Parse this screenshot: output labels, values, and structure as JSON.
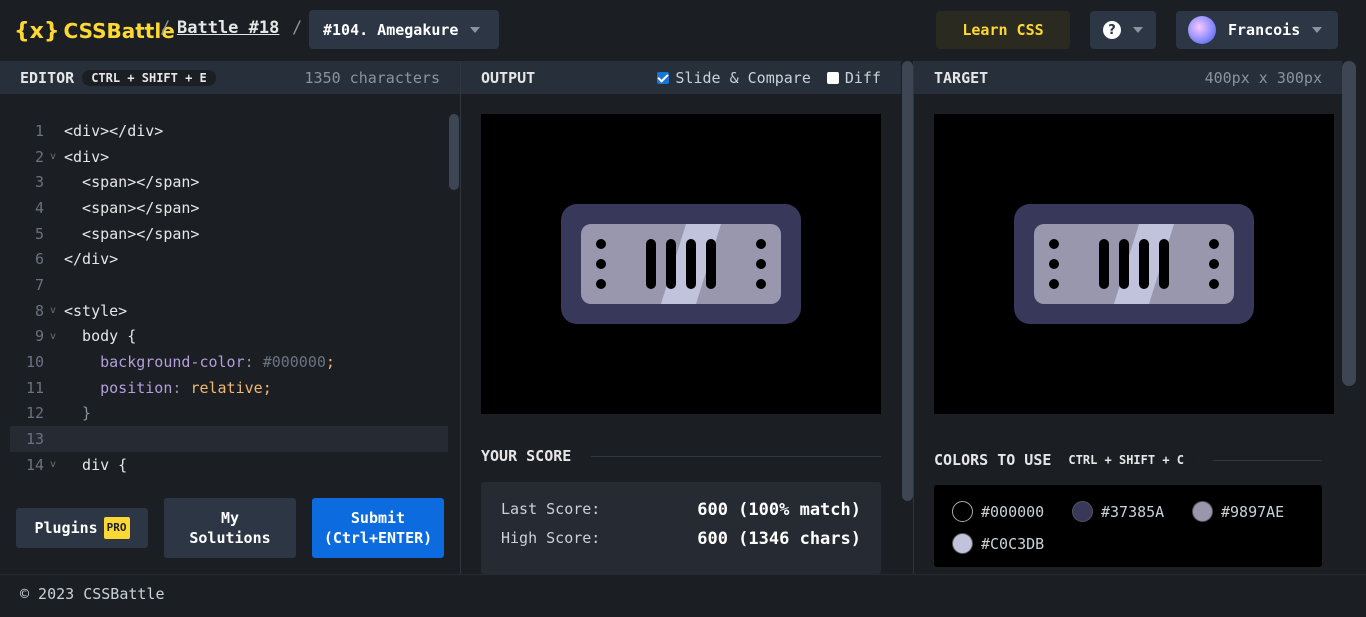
{
  "header": {
    "logo_text": "CSSBattle",
    "logo_mark": "{x}",
    "battle_label": "Battle #18",
    "target_select": "#104. Amegakure",
    "learn_label": "Learn CSS",
    "help_label": "?",
    "user_name": "Francois"
  },
  "editor": {
    "title": "EDITOR",
    "shortcut": "CTRL + SHIFT + E",
    "char_count": "1350 characters",
    "lines": [
      {
        "n": "1",
        "text": "<div></div>"
      },
      {
        "n": "2",
        "text": "<div>"
      },
      {
        "n": "3",
        "text": "  <span></span>"
      },
      {
        "n": "4",
        "text": "  <span></span>"
      },
      {
        "n": "5",
        "text": "  <span></span>"
      },
      {
        "n": "6",
        "text": "</div>"
      },
      {
        "n": "7",
        "text": ""
      },
      {
        "n": "8",
        "text": "<style>"
      },
      {
        "n": "9",
        "text": "  body {"
      },
      {
        "n": "10",
        "prop": "background-color",
        "val": "#000000"
      },
      {
        "n": "11",
        "prop": "position",
        "val": "relative"
      },
      {
        "n": "12",
        "text": "  }"
      },
      {
        "n": "13",
        "text": ""
      },
      {
        "n": "14",
        "text": "  div {"
      }
    ],
    "plugins_label": "Plugins",
    "pro_badge": "PRO",
    "solutions_label": "My Solutions",
    "submit_label": "Submit (Ctrl+ENTER)"
  },
  "output": {
    "title": "OUTPUT",
    "slide_label": "Slide & Compare",
    "diff_label": "Diff",
    "score_title": "YOUR SCORE",
    "last_score_label": "Last Score:",
    "last_score_value": "600 (100% match)",
    "high_score_label": "High Score:",
    "high_score_value": "600 (1346 chars)"
  },
  "target": {
    "title": "TARGET",
    "dimensions": "400px x 300px",
    "colors_title": "COLORS TO USE",
    "colors_shortcut": "CTRL + SHIFT + C",
    "colors": [
      "#000000",
      "#37385A",
      "#9897AE",
      "#C0C3DB"
    ]
  },
  "footer": {
    "text": "© 2023 CSSBattle"
  }
}
